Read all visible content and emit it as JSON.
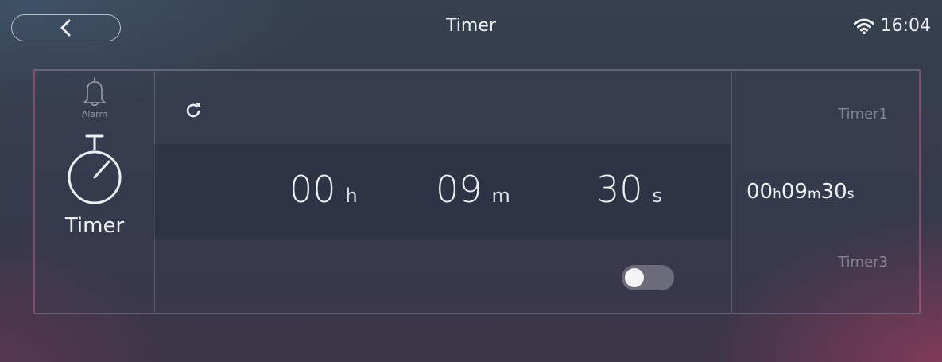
{
  "header": {
    "title": "Timer",
    "clock": "16:04",
    "back_icon": "chevron-left-icon",
    "wifi_icon": "wifi-icon"
  },
  "sidebar": {
    "alarm_label": "Alarm",
    "timer_label": "Timer"
  },
  "countdown": {
    "hours": "00",
    "hours_unit": "h",
    "minutes": "09",
    "minutes_unit": "m",
    "seconds": "30",
    "seconds_unit": "s",
    "toggle_on": false
  },
  "timers": {
    "item1": "Timer1",
    "active_h": "00",
    "active_h_unit": "h",
    "active_m": "09",
    "active_m_unit": "m",
    "active_s": "30",
    "active_s_unit": "s",
    "item3": "Timer3"
  },
  "colors": {
    "accent_pink": "#c85a78",
    "text": "#eef0f4"
  }
}
